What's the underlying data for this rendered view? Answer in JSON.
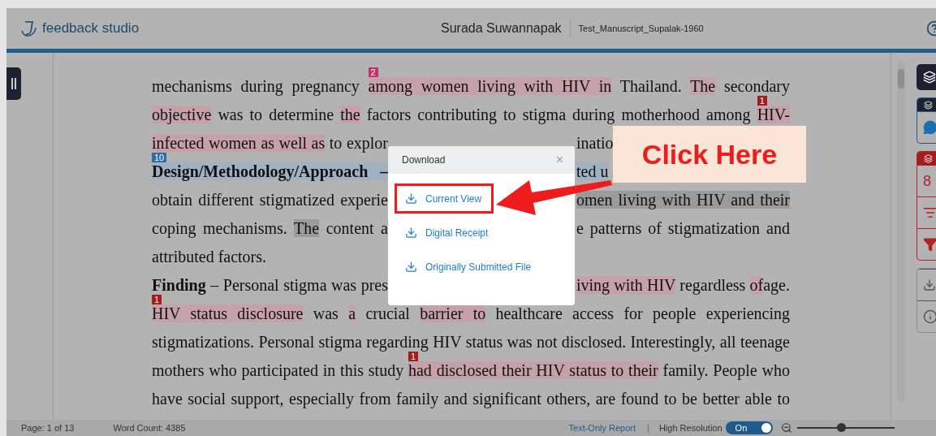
{
  "header": {
    "brand": "feedback studio",
    "user": "Surada Suwannapak",
    "document": "Test_Manuscript_Supalak-1960"
  },
  "document": {
    "lines": [
      {
        "segments": [
          {
            "text": "mechanisms during pregnancy "
          },
          {
            "text": "among women living with HIV in",
            "color": "#c7a1a9",
            "badge": {
              "label": "2",
              "color": "#c2306e"
            }
          },
          {
            "text": " Thailand. "
          },
          {
            "text": "The",
            "color": "#c7a1a9"
          },
          {
            "text": " secondary"
          }
        ]
      },
      {
        "segments": [
          {
            "text": "objective",
            "color": "#c7a1a9"
          },
          {
            "text": " was to determine "
          },
          {
            "text": "the",
            "color": "#c7a1a9"
          },
          {
            "text": " factors contributing to stigma during motherhood among "
          },
          {
            "text": "HIV-",
            "color": "#c7a1a9",
            "badge": {
              "label": "1",
              "color": "#a31d1d"
            }
          }
        ]
      },
      {
        "segments": [
          {
            "text": "infected women as well as",
            "color": "#c7a1a9"
          },
          {
            "text": " to explor"
          }
        ],
        "after_gap": [
          {
            "text": "inatio"
          }
        ],
        "cut": true
      },
      {
        "segments": [
          {
            "text": "Design/Methodology/Approach –",
            "color": "#a0b1c2",
            "bold": true,
            "badge": {
              "label": "10",
              "color": "#2f6ea5"
            }
          }
        ],
        "after_gap": [
          {
            "text": "ted u",
            "color": "#a0b1c2"
          }
        ],
        "cut": true
      },
      {
        "segments": [
          {
            "text": "obtain different stigmatized experie"
          }
        ],
        "after_gap": [
          {
            "text": "omen living with HIV and their",
            "color": "#9b9b9b"
          }
        ]
      },
      {
        "segments": [
          {
            "text": "coping mechanisms. "
          },
          {
            "text": "The",
            "color": "#9b9b9b"
          },
          {
            "text": " content a"
          }
        ],
        "after_gap": [
          {
            "text": "e patterns of stigmatization and"
          }
        ]
      },
      {
        "segments": [
          {
            "text": "attributed factors."
          }
        ],
        "paragraph_end": true
      },
      {
        "segments": [
          {
            "text": "Finding",
            "bold": true
          },
          {
            "text": " – Personal stigma was pres"
          }
        ],
        "after_gap": [
          {
            "text": "iving with HIV",
            "color": "#c7a1a9"
          },
          {
            "text": " regardless "
          },
          {
            "text": "of",
            "color": "#c7a1a9"
          },
          {
            "text": "age."
          }
        ]
      },
      {
        "segments": [
          {
            "text": "HIV status disclosure",
            "color": "#c7a1a9",
            "badge": {
              "label": "1",
              "color": "#a31d1d"
            }
          },
          {
            "text": " was "
          },
          {
            "text": "a",
            "color": "#c7a1a9"
          },
          {
            "text": " crucial "
          },
          {
            "text": "barrier to",
            "color": "#c7a1a9"
          },
          {
            "text": " healthcare access for people experiencing"
          }
        ]
      },
      {
        "segments": [
          {
            "text": "stigmatizations. Personal stigma regarding HIV status was not disclosed. Interestingly, all teenage"
          }
        ]
      },
      {
        "segments": [
          {
            "text": "mothers who participated in this study "
          },
          {
            "text": "had disclosed their HIV status to their",
            "color": "#c7a1a9",
            "badge": {
              "label": "1",
              "color": "#a31d1d"
            }
          },
          {
            "text": " family. People who"
          }
        ]
      },
      {
        "segments": [
          {
            "text": "have social support, especially from family and significant others, are found to be better able to"
          }
        ]
      }
    ]
  },
  "side_tools": {
    "match_count": "8"
  },
  "dialog": {
    "title": "Download",
    "close": "×",
    "items": [
      {
        "label": "Current View",
        "highlighted": true
      },
      {
        "label": "Digital Receipt",
        "highlighted": false
      },
      {
        "label": "Originally Submitted File",
        "highlighted": false
      }
    ]
  },
  "callout": {
    "text": "Click Here"
  },
  "status_bar": {
    "page": "Page: 1 of 13",
    "word_count": "Word Count: 4385",
    "report_link": "Text-Only Report",
    "separator": "|",
    "resolution_label": "High Resolution",
    "resolution_toggle": {
      "label": "On",
      "on": true
    },
    "zoom": {
      "level": 0.45
    }
  }
}
